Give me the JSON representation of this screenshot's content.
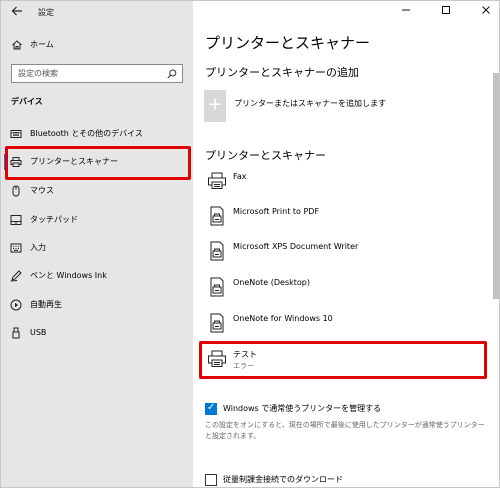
{
  "window": {
    "app_title": "設定",
    "controls": {
      "minimize": "—",
      "maximize": "☐",
      "close": "✕"
    }
  },
  "sidebar": {
    "home_label": "ホーム",
    "search_placeholder": "設定の検索",
    "section_label": "デバイス",
    "items": [
      {
        "label": "Bluetooth とその他のデバイス",
        "icon": "bluetooth-devices-icon"
      },
      {
        "label": "プリンターとスキャナー",
        "icon": "printer-icon",
        "active": true
      },
      {
        "label": "マウス",
        "icon": "mouse-icon"
      },
      {
        "label": "タッチパッド",
        "icon": "touchpad-icon"
      },
      {
        "label": "入力",
        "icon": "keyboard-icon"
      },
      {
        "label": "ペンと Windows Ink",
        "icon": "pen-icon"
      },
      {
        "label": "自動再生",
        "icon": "autoplay-icon"
      },
      {
        "label": "USB",
        "icon": "usb-icon"
      }
    ]
  },
  "main": {
    "title": "プリンターとスキャナー",
    "add_heading": "プリンターとスキャナーの追加",
    "add_button_label": "プリンターまたはスキャナーを追加します",
    "list_heading": "プリンターとスキャナー",
    "printers": [
      {
        "name": "Fax",
        "icon": "fax-printer-icon",
        "status": ""
      },
      {
        "name": "Microsoft Print to PDF",
        "icon": "document-printer-icon",
        "status": ""
      },
      {
        "name": "Microsoft XPS Document Writer",
        "icon": "document-printer-icon",
        "status": ""
      },
      {
        "name": "OneNote (Desktop)",
        "icon": "document-printer-icon",
        "status": ""
      },
      {
        "name": "OneNote for Windows 10",
        "icon": "document-printer-icon",
        "status": ""
      },
      {
        "name": "テスト",
        "icon": "printer-icon",
        "status": "エラー"
      }
    ],
    "manage_default_label": "Windows で通常使うプリンターを管理する",
    "manage_default_checked": true,
    "manage_default_desc": "この設定をオンにすると、現在の場所で最後に使用したプリンターが通常使うプリンターと設定されます。",
    "metered_label": "従量制課金接続でのダウンロード",
    "metered_checked": false
  },
  "colors": {
    "accent": "#0078d7",
    "highlight": "#e00000",
    "sidebar_bg": "#e6e6e6"
  }
}
